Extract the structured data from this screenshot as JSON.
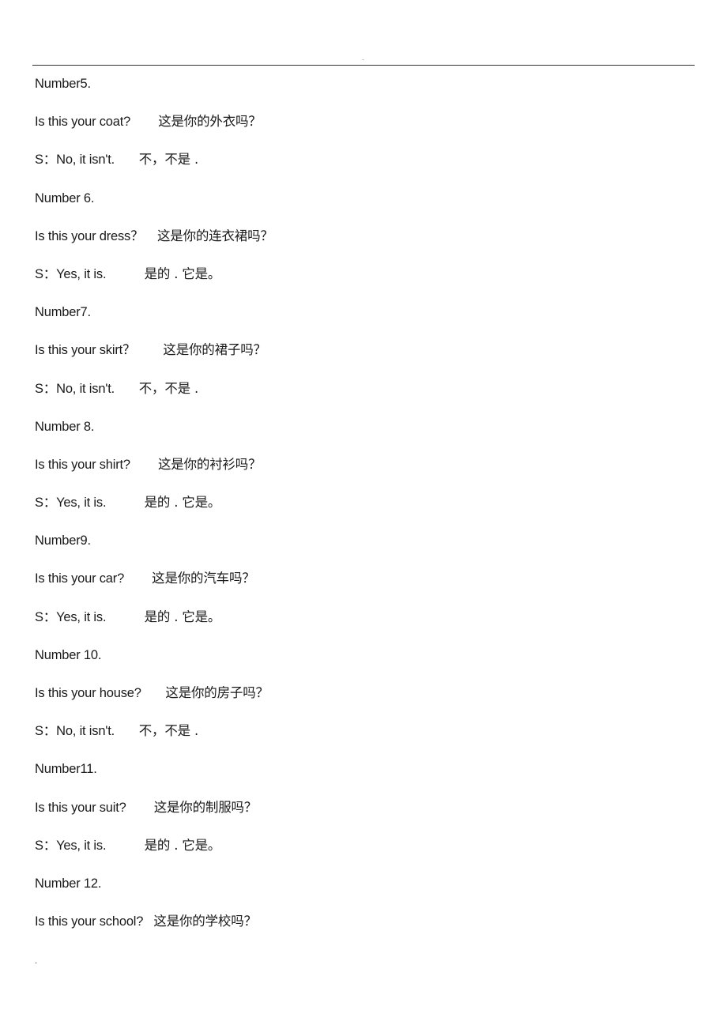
{
  "header": {
    "marker": "."
  },
  "entries": [
    {
      "type": "heading",
      "text": "Number5."
    },
    {
      "type": "question",
      "en": "Is this your coat?",
      "gap": "        ",
      "zh": "这是你的外衣吗？"
    },
    {
      "type": "answer",
      "en": "S：No, it isn't.",
      "gap": "       ",
      "zh": "不，不是 ."
    },
    {
      "type": "heading",
      "text": "Number 6."
    },
    {
      "type": "question",
      "en": "Is this your dress？",
      "gap": "    ",
      "zh": "这是你的连衣裙吗？"
    },
    {
      "type": "answer",
      "en": "S：Yes, it is.",
      "gap": "           ",
      "zh": "是的 . 它是。"
    },
    {
      "type": "heading",
      "text": "Number7."
    },
    {
      "type": "question",
      "en": "Is this your skirt？",
      "gap": "        ",
      "zh": "这是你的裙子吗？"
    },
    {
      "type": "answer",
      "en": "S：No, it isn't.",
      "gap": "       ",
      "zh": "不，不是 ."
    },
    {
      "type": "heading",
      "text": "Number 8."
    },
    {
      "type": "question",
      "en": "Is this your shirt?",
      "gap": "        ",
      "zh": "这是你的衬衫吗？"
    },
    {
      "type": "answer",
      "en": "S：Yes, it is.",
      "gap": "           ",
      "zh": "是的 . 它是。"
    },
    {
      "type": "heading",
      "text": "Number9."
    },
    {
      "type": "question",
      "en": "Is this your car?",
      "gap": "        ",
      "zh": "这是你的汽车吗？"
    },
    {
      "type": "answer",
      "en": "S：Yes, it is.",
      "gap": "           ",
      "zh": "是的 . 它是。"
    },
    {
      "type": "heading",
      "text": "Number 10."
    },
    {
      "type": "question",
      "en": "Is this your house?",
      "gap": "       ",
      "zh": "这是你的房子吗？"
    },
    {
      "type": "answer",
      "en": "S：No, it isn't.",
      "gap": "       ",
      "zh": "不，不是 ."
    },
    {
      "type": "heading",
      "text": "Number11."
    },
    {
      "type": "question",
      "en": "Is this your suit?",
      "gap": "        ",
      "zh": "这是你的制服吗？"
    },
    {
      "type": "answer",
      "en": "S：Yes, it is.",
      "gap": "           ",
      "zh": "是的 . 它是。"
    },
    {
      "type": "heading",
      "text": "Number 12."
    },
    {
      "type": "question",
      "en": "Is this your school?",
      "gap": "   ",
      "zh": "这是你的学校吗？"
    }
  ],
  "footer": {
    "marker": "."
  }
}
